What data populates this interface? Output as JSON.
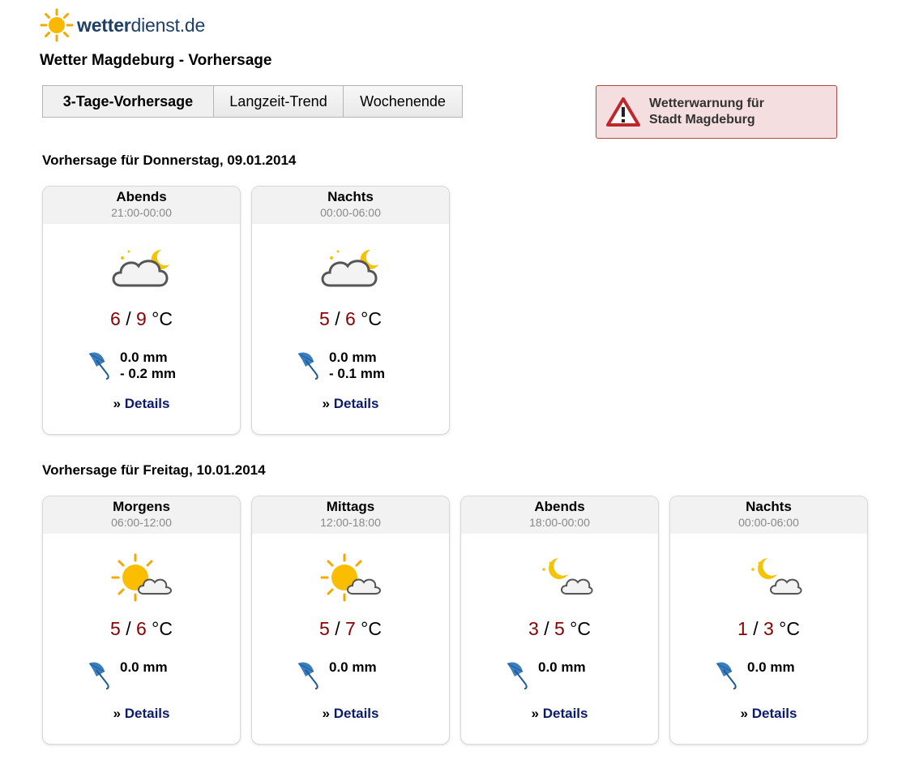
{
  "logo": {
    "bold": "wetter",
    "light": "dienst.de"
  },
  "page_title": "Wetter Magdeburg - Vorhersage",
  "tabs": [
    {
      "label": "3-Tage-Vorhersage",
      "active": true
    },
    {
      "label": "Langzeit-Trend",
      "active": false
    },
    {
      "label": "Wochenende",
      "active": false
    }
  ],
  "warning": {
    "line1": "Wetterwarnung für",
    "line2": "Stadt Magdeburg"
  },
  "days": [
    {
      "heading": "Vorhersage für Donnerstag, 09.01.2014",
      "cards": [
        {
          "period": "Abends",
          "time": "21:00-00:00",
          "icon": "night-cloudy-icon",
          "tmin": "6",
          "tmax": "9",
          "unit": "°C",
          "rain1": "0.0 mm",
          "rain2": "- 0.2 mm",
          "details_prefix": "»",
          "details": "Details"
        },
        {
          "period": "Nachts",
          "time": "00:00-06:00",
          "icon": "night-cloudy-icon",
          "tmin": "5",
          "tmax": "6",
          "unit": "°C",
          "rain1": "0.0 mm",
          "rain2": "- 0.1 mm",
          "details_prefix": "»",
          "details": "Details"
        }
      ]
    },
    {
      "heading": "Vorhersage für Freitag, 10.01.2014",
      "cards": [
        {
          "period": "Morgens",
          "time": "06:00-12:00",
          "icon": "sun-cloud-icon",
          "tmin": "5",
          "tmax": "6",
          "unit": "°C",
          "rain1": "0.0 mm",
          "rain2": "",
          "details_prefix": "»",
          "details": "Details"
        },
        {
          "period": "Mittags",
          "time": "12:00-18:00",
          "icon": "sun-cloud-icon",
          "tmin": "5",
          "tmax": "7",
          "unit": "°C",
          "rain1": "0.0 mm",
          "rain2": "",
          "details_prefix": "»",
          "details": "Details"
        },
        {
          "period": "Abends",
          "time": "18:00-00:00",
          "icon": "moon-cloud-icon",
          "tmin": "3",
          "tmax": "5",
          "unit": "°C",
          "rain1": "0.0 mm",
          "rain2": "",
          "details_prefix": "»",
          "details": "Details"
        },
        {
          "period": "Nachts",
          "time": "00:00-06:00",
          "icon": "moon-cloud-icon",
          "tmin": "1",
          "tmax": "3",
          "unit": "°C",
          "rain1": "0.0 mm",
          "rain2": "",
          "details_prefix": "»",
          "details": "Details"
        }
      ]
    }
  ],
  "colors": {
    "temp": "#8b0000",
    "link": "#0a1a6e",
    "warning_bg": "#f5dedf",
    "warning_border": "#b04a4a",
    "logo": "#1f3f66"
  }
}
